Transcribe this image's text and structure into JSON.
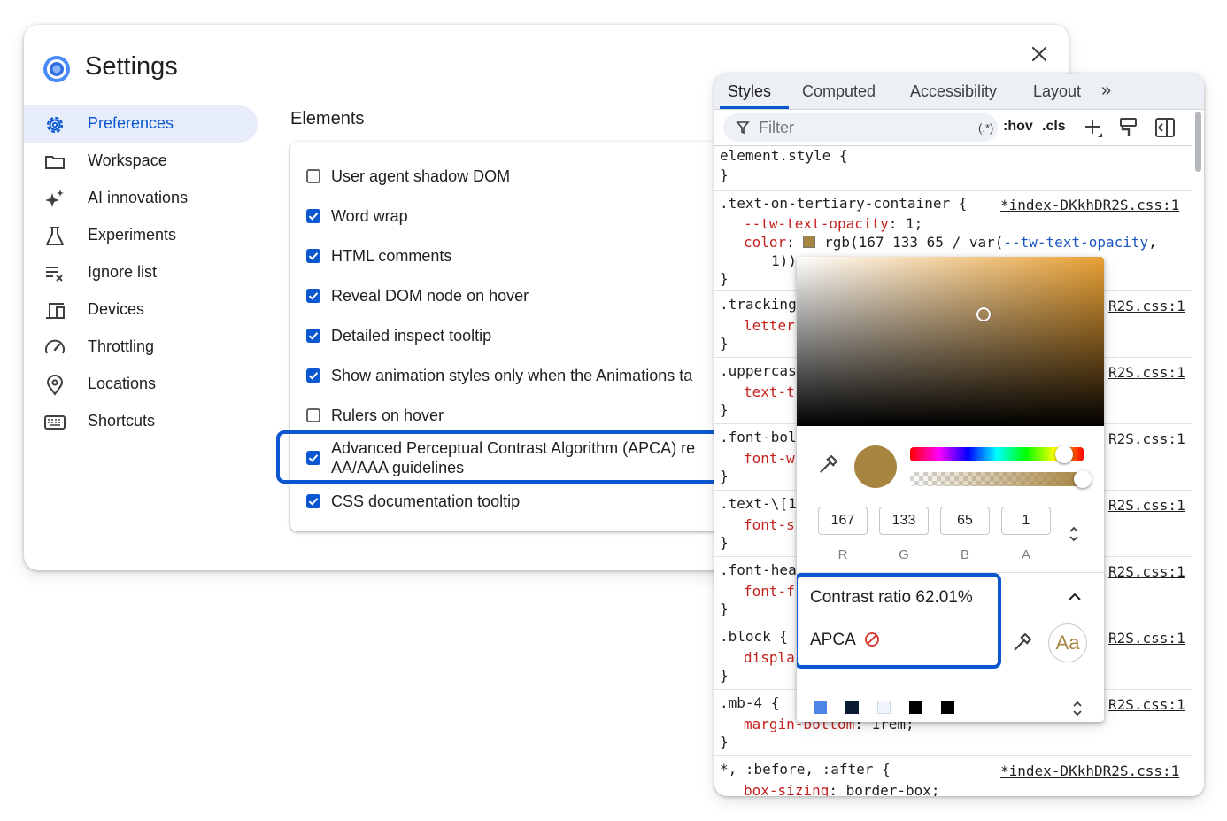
{
  "settings": {
    "title": "Settings",
    "nav": [
      {
        "label": "Preferences",
        "icon": "gear-icon",
        "active": true
      },
      {
        "label": "Workspace",
        "icon": "folder-icon"
      },
      {
        "label": "AI innovations",
        "icon": "sparkle-icon"
      },
      {
        "label": "Experiments",
        "icon": "flask-icon"
      },
      {
        "label": "Ignore list",
        "icon": "ignore-list-icon"
      },
      {
        "label": "Devices",
        "icon": "devices-icon"
      },
      {
        "label": "Throttling",
        "icon": "speedometer-icon"
      },
      {
        "label": "Locations",
        "icon": "location-pin-icon"
      },
      {
        "label": "Shortcuts",
        "icon": "keyboard-icon"
      }
    ],
    "section_heading": "Elements",
    "options": [
      {
        "label": "User agent shadow DOM",
        "checked": false
      },
      {
        "label": "Word wrap",
        "checked": true
      },
      {
        "label": "HTML comments",
        "checked": true
      },
      {
        "label": "Reveal DOM node on hover",
        "checked": true
      },
      {
        "label": "Detailed inspect tooltip",
        "checked": true
      },
      {
        "label": "Show animation styles only when the Animations ta",
        "checked": true
      },
      {
        "label": "Rulers on hover",
        "checked": false
      },
      {
        "label": "Advanced Perceptual Contrast Algorithm (APCA) re",
        "label_line2": "AA/AAA guidelines",
        "checked": true
      },
      {
        "label": "CSS documentation tooltip",
        "checked": true
      }
    ]
  },
  "devtools": {
    "tabs": [
      "Styles",
      "Computed",
      "Accessibility",
      "Layout"
    ],
    "active_tab": "Styles",
    "more_tabs": "»",
    "filter_placeholder": "Filter",
    "regex_btn": "(.*)",
    "hov_btn": ":hov",
    "cls_btn": ".cls",
    "rules": {
      "element_style": {
        "selector": "element.style {",
        "close": "}"
      },
      "text_on": {
        "selector": ".text-on-tertiary-container {",
        "source": "*index-DKkhDR2S.css:1",
        "p1_name": "--tw-text-opacity",
        "p1_value": "1;",
        "p2_name": "color",
        "p2_rgb": "rgb(167 133 65 / ",
        "p2_var_fn": "var(",
        "p2_var": "--tw-text-opacity",
        "p2_tail": ",",
        "p2_cont": "1))",
        "close": "}"
      },
      "tracking": {
        "selector": ".tracking",
        "prop": "letter",
        "source": "R2S.css:1",
        "close": "}"
      },
      "uppercase": {
        "selector": ".uppercas",
        "prop": "text-t",
        "source": "R2S.css:1",
        "close": "}"
      },
      "font_bold": {
        "selector": ".font-bol",
        "prop": "font-w",
        "source": "R2S.css:1",
        "close": "}"
      },
      "text_esc": {
        "selector": ".text-\\[1",
        "prop": "font-s",
        "source": "R2S.css:1",
        "close": "}"
      },
      "font_head": {
        "selector": ".font-hea",
        "prop": "font-f",
        "source": "R2S.css:1",
        "close": "}"
      },
      "block": {
        "selector": ".block {",
        "prop": "displa",
        "source": "R2S.css:1",
        "close": "}"
      },
      "mb4": {
        "selector": ".mb-4 {",
        "prop": "margin-bottom",
        "value": "1rem;",
        "source": "R2S.css:1",
        "close": "}"
      },
      "universal": {
        "selector": "*, :before, :after {",
        "prop": "box-sizing",
        "value": "border-box;",
        "source": "*index-DKkhDR2S.css:1"
      }
    }
  },
  "picker": {
    "color_hex": "#a78541",
    "r": "167",
    "g": "133",
    "b": "65",
    "a": "1",
    "r_label": "R",
    "g_label": "G",
    "b_label": "B",
    "a_label": "A",
    "contrast_label": "Contrast ratio",
    "contrast_value": "62.01%",
    "apca_label": "APCA",
    "preview_text": "Aa",
    "palette": [
      "#4f85e6",
      "#0a1a33",
      "#f0f5ff",
      "#000000",
      "#000000"
    ]
  }
}
